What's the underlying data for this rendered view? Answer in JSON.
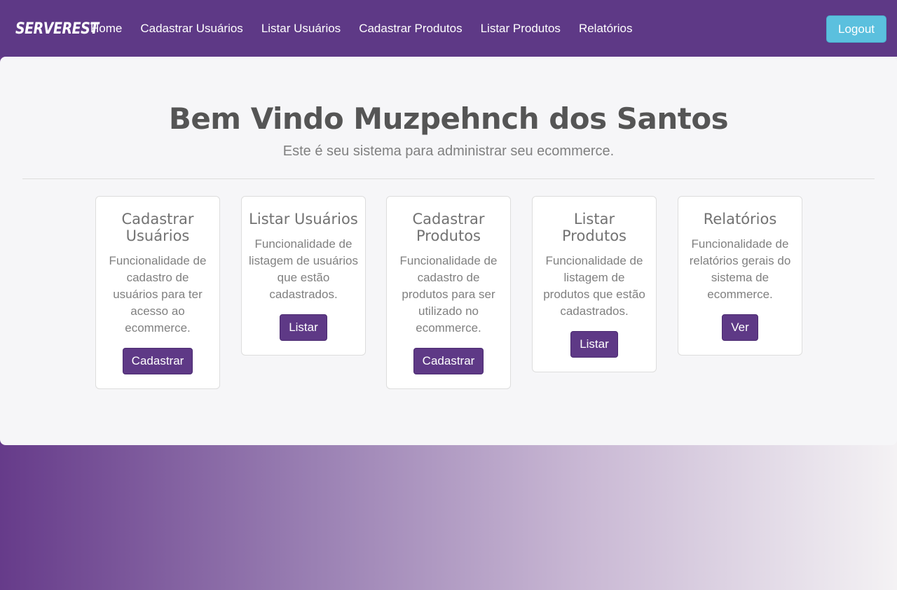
{
  "navbar": {
    "brand": "SERVEREST",
    "links": [
      "Home",
      "Cadastrar Usuários",
      "Listar Usuários",
      "Cadastrar Produtos",
      "Listar Produtos",
      "Relatórios"
    ],
    "logout_label": "Logout"
  },
  "main": {
    "title": "Bem Vindo Muzpehnch dos Santos",
    "subtitle": "Este é seu sistema para administrar seu ecommerce.",
    "cards": [
      {
        "title": "Cadastrar Usuários",
        "text": "Funcionalidade de cadastro de usuários para ter acesso ao ecommerce.",
        "button": "Cadastrar"
      },
      {
        "title": "Listar Usuários",
        "text": "Funcionalidade de listagem de usuários que estão cadastrados.",
        "button": "Listar"
      },
      {
        "title": "Cadastrar Produtos",
        "text": "Funcionalidade de cadastro de produtos para ser utilizado no ecommerce.",
        "button": "Cadastrar"
      },
      {
        "title": "Listar Produtos",
        "text": "Funcionalidade de listagem de produtos que estão cadastrados.",
        "button": "Listar"
      },
      {
        "title": "Relatórios",
        "text": "Funcionalidade de relatórios gerais do sistema de ecommerce.",
        "button": "Ver"
      }
    ]
  },
  "colors": {
    "nav_bg": "#5e3986",
    "logout_bg": "#5bc0de",
    "button_bg": "#5e3986",
    "panel_bg": "#f6f6f8"
  }
}
